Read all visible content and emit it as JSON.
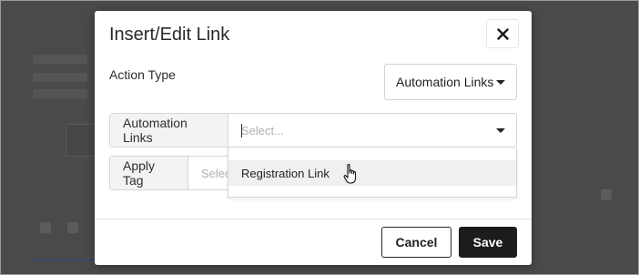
{
  "modal": {
    "title": "Insert/Edit Link",
    "close_icon": "close-icon"
  },
  "action_type": {
    "label": "Action Type",
    "selected": "Automation Links"
  },
  "automation_links": {
    "addon_label": "Automation Links",
    "placeholder": "Select...",
    "options": [
      "Registration Link"
    ]
  },
  "apply_tag": {
    "addon_label": "Apply Tag",
    "placeholder": "Selec"
  },
  "footer": {
    "cancel_label": "Cancel",
    "save_label": "Save"
  }
}
